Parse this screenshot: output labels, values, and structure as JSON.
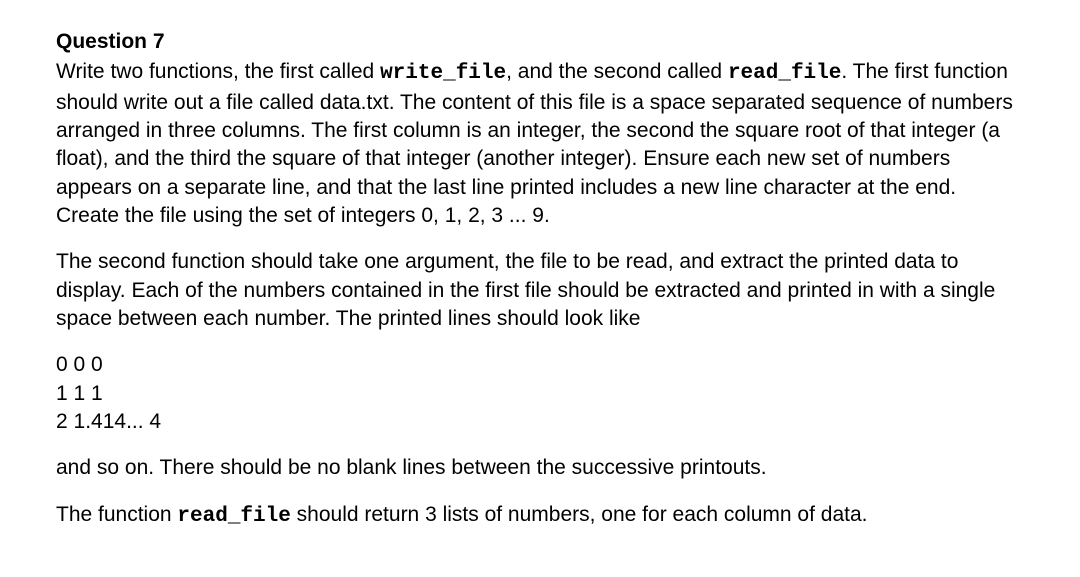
{
  "heading": "Question 7",
  "para1": {
    "t1": "Write two functions, the first called ",
    "c1": "write_file",
    "t2": ", and the second called ",
    "c2": "read_file",
    "t3": ". The first function should write out a file called data.txt. The content of this file is a space separated sequence of numbers arranged in three columns.   The first column is an integer, the second the square root of that integer (a float), and the third the square of that integer (another integer).   Ensure each new set of numbers appears on a separate line, and that the last line printed includes a new line character at the end.  Create the file using the set of integers 0, 1, 2, 3 ... 9."
  },
  "para2": "The second function should take one argument, the file to be read, and extract the printed data to display.  Each of the numbers contained in the first file should be extracted and printed in with a single space between each number.  The printed lines should look like",
  "output": {
    "l1": "0 0 0",
    "l2": "1 1 1",
    "l3": "2 1.414... 4"
  },
  "para3": "and so on.  There should be no blank lines between the successive printouts.",
  "para4": {
    "t1": "The function ",
    "c1": "read_file",
    "t2": " should return 3 lists of numbers, one for each column of data."
  }
}
